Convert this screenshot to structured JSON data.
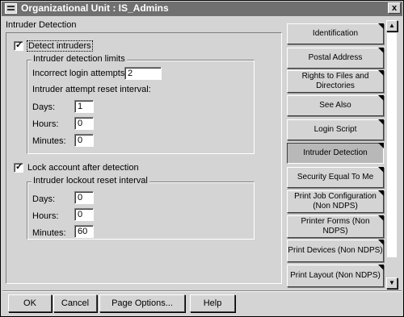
{
  "window": {
    "title": "Organizational Unit : IS_Admins",
    "close_glyph": "x"
  },
  "page": {
    "title": "Intruder Detection"
  },
  "detect": {
    "checkbox_label": "Detect intruders",
    "checked": true,
    "limits_legend": "Intruder detection limits",
    "incorrect_login_label": "Incorrect login attempts:",
    "incorrect_login_value": "2",
    "reset_interval_label": "Intruder attempt reset interval:",
    "days_label": "Days:",
    "days_value": "1",
    "hours_label": "Hours:",
    "hours_value": "0",
    "minutes_label": "Minutes:",
    "minutes_value": "0"
  },
  "lockout": {
    "checkbox_label": "Lock account after detection",
    "checked": true,
    "legend": "Intruder lockout reset interval",
    "days_label": "Days:",
    "days_value": "0",
    "hours_label": "Hours:",
    "hours_value": "0",
    "minutes_label": "Minutes:",
    "minutes_value": "60"
  },
  "sidebar": {
    "tabs": [
      {
        "label": "Identification"
      },
      {
        "label": "Postal Address"
      },
      {
        "label": "Rights to Files and Directories"
      },
      {
        "label": "See Also"
      },
      {
        "label": "Login Script"
      },
      {
        "label": "Intruder Detection",
        "active": true
      },
      {
        "label": "Security Equal To Me"
      },
      {
        "label": "Print Job Configuration (Non NDPS)"
      },
      {
        "label": "Printer Forms (Non NDPS)"
      },
      {
        "label": "Print Devices (Non NDPS)"
      },
      {
        "label": "Print Layout (Non NDPS)"
      }
    ],
    "scroll_up_glyph": "▲",
    "scroll_down_glyph": "▼"
  },
  "buttons": {
    "ok": "OK",
    "cancel": "Cancel",
    "page_options": "Page Options...",
    "help": "Help"
  }
}
